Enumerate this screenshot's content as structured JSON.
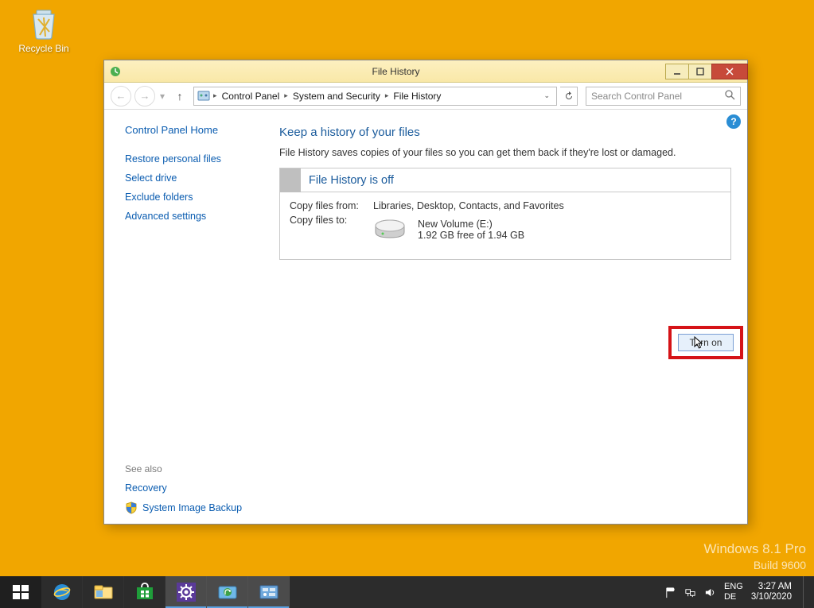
{
  "desktop": {
    "recycle_bin": "Recycle Bin"
  },
  "watermark": {
    "line1": "Windows 8.1 Pro",
    "line2": "Build 9600"
  },
  "window": {
    "title": "File History",
    "breadcrumb": [
      "Control Panel",
      "System and Security",
      "File History"
    ],
    "search_placeholder": "Search Control Panel"
  },
  "sidebar": {
    "home": "Control Panel Home",
    "links": [
      "Restore personal files",
      "Select drive",
      "Exclude folders",
      "Advanced settings"
    ],
    "see_also_label": "See also",
    "see_also": [
      "Recovery",
      "System Image Backup"
    ]
  },
  "main": {
    "heading": "Keep a history of your files",
    "subtitle": "File History saves copies of your files so you can get them back if they're lost or damaged.",
    "status_title": "File History is off",
    "copy_from_label": "Copy files from:",
    "copy_from_value": "Libraries, Desktop, Contacts, and Favorites",
    "copy_to_label": "Copy files to:",
    "drive_name": "New Volume (E:)",
    "drive_space": "1.92 GB free of 1.94 GB",
    "turn_on": "Turn on"
  },
  "tray": {
    "lang1": "ENG",
    "lang2": "DE",
    "time": "3:27 AM",
    "date": "3/10/2020"
  }
}
